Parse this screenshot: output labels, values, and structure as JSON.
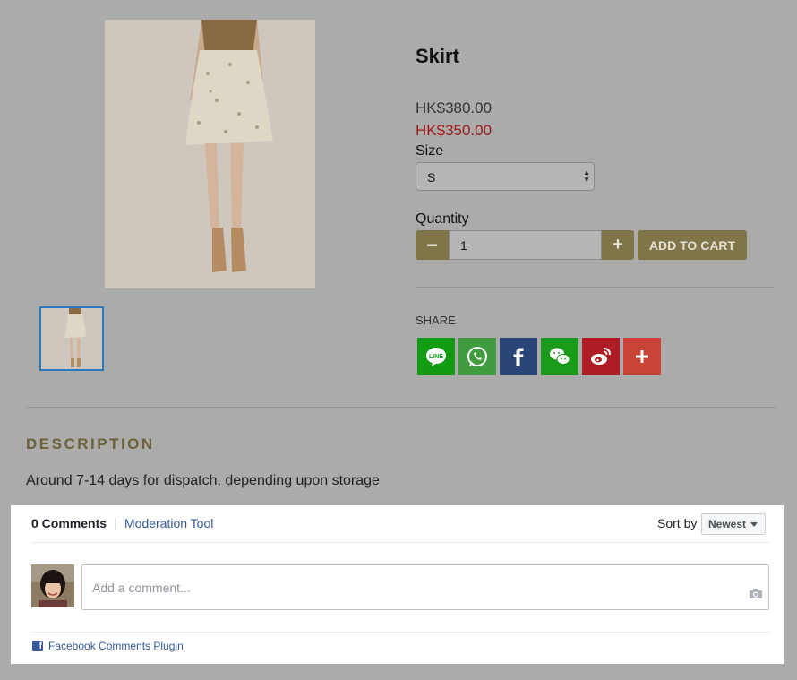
{
  "product": {
    "title": "Skirt",
    "old_price": "HK$380.00",
    "new_price": "HK$350.00",
    "size_label": "Size",
    "size_value": "S",
    "quantity_label": "Quantity",
    "quantity_value": "1",
    "add_to_cart": "ADD TO CART",
    "share_label": "SHARE",
    "share_buttons": [
      "line-icon",
      "whatsapp-icon",
      "facebook-icon",
      "wechat-icon",
      "weibo-icon",
      "more-share-icon"
    ]
  },
  "description": {
    "title": "DESCRIPTION",
    "text": "Around 7-14 days for dispatch, depending upon storage"
  },
  "comments": {
    "count": "0 Comments",
    "moderation": "Moderation Tool",
    "sort_label": "Sort by",
    "sort_value": "Newest",
    "placeholder": "Add a comment...",
    "footer": "Facebook Comments Plugin"
  },
  "colors": {
    "accent": "#807449",
    "price_sale": "#a01818",
    "link": "#365899",
    "thumb_border": "#2b78c2"
  }
}
